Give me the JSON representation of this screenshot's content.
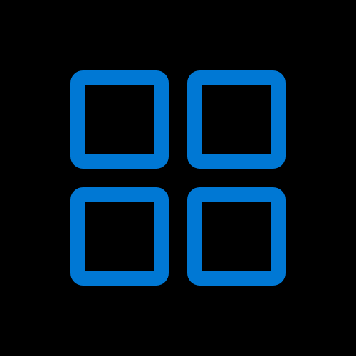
{
  "icon": {
    "name": "grid-view-icon",
    "tiles": [
      "tile-top-left",
      "tile-top-right",
      "tile-bottom-left",
      "tile-bottom-right"
    ]
  },
  "colors": {
    "background": "#000000",
    "stroke": "#0078D4"
  }
}
